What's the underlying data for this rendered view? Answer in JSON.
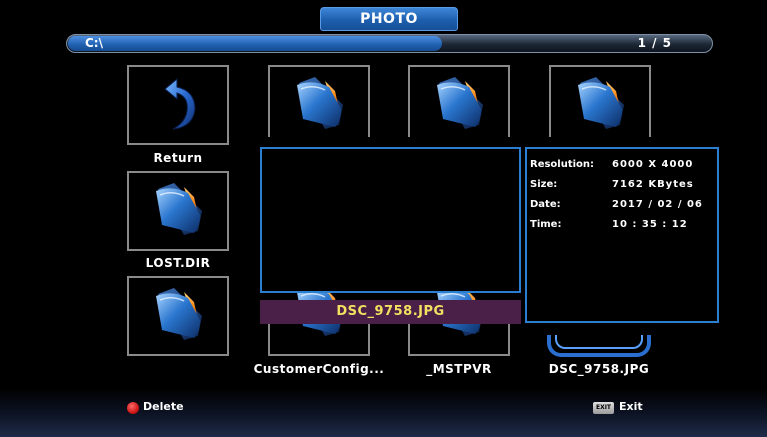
{
  "header": {
    "title": "PHOTO"
  },
  "path_bar": {
    "path": "C:\\",
    "page": "1 / 5"
  },
  "items": [
    {
      "label": "Return",
      "icon": "return-arrow-icon"
    },
    {
      "label": "",
      "icon": "folder-icon"
    },
    {
      "label": "",
      "icon": "folder-icon"
    },
    {
      "label": "",
      "icon": "folder-icon"
    },
    {
      "label": "LOST.DIR",
      "icon": "folder-icon"
    },
    {
      "label": "",
      "icon": "folder-icon"
    },
    {
      "label": "CustomerConfig...",
      "icon": "folder-icon"
    },
    {
      "label": "_MSTPVR",
      "icon": "folder-icon"
    },
    {
      "label": "DSC_9758.JPG",
      "icon": "image-thumbnail"
    }
  ],
  "preview": {
    "filename": "DSC_9758.JPG",
    "info": [
      {
        "key": "Resolution:",
        "value": "6000 X 4000"
      },
      {
        "key": "Size:",
        "value": "7162 KBytes"
      },
      {
        "key": "Date:",
        "value": "2017 / 02 / 06"
      },
      {
        "key": "Time:",
        "value": "10 : 35 : 12"
      }
    ]
  },
  "footer": {
    "delete_label": "Delete",
    "exit_key": "EXIT",
    "exit_label": "Exit"
  },
  "colors": {
    "accent_blue": "#2a7fd0",
    "filename_bar": "#4b2048",
    "filename_text": "#f2e060",
    "delete_red": "#d01818"
  }
}
